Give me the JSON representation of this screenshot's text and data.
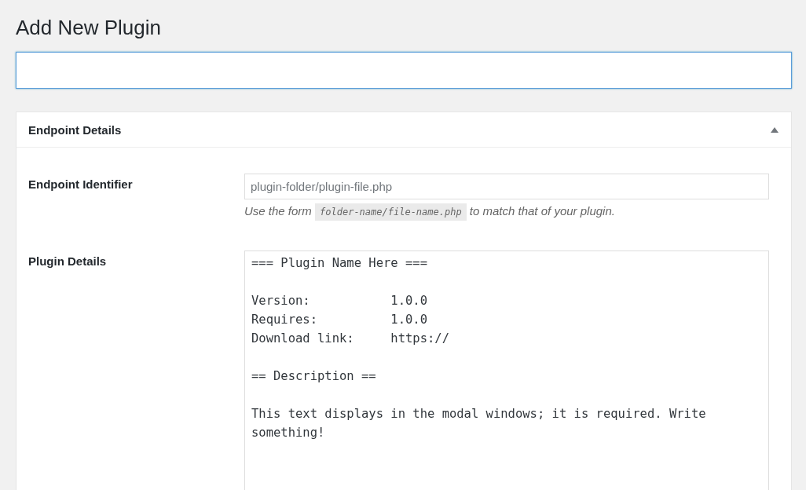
{
  "page_title": "Add New Plugin",
  "title_field": {
    "focused": true
  },
  "panel": {
    "title": "Endpoint Details",
    "expanded": true,
    "identifier": {
      "label": "Endpoint Identifier",
      "placeholder": "plugin-folder/plugin-file.php",
      "hint_before": "Use the form",
      "hint_code": "folder-name/file-name.php",
      "hint_after": "to match that of your plugin."
    },
    "details": {
      "label": "Plugin Details",
      "value": "=== Plugin Name Here ===\n\nVersion:           1.0.0\nRequires:          1.0.0\nDownload link:     https://\n\n== Description ==\n\nThis text displays in the modal windows; it is required. Write something!"
    }
  }
}
